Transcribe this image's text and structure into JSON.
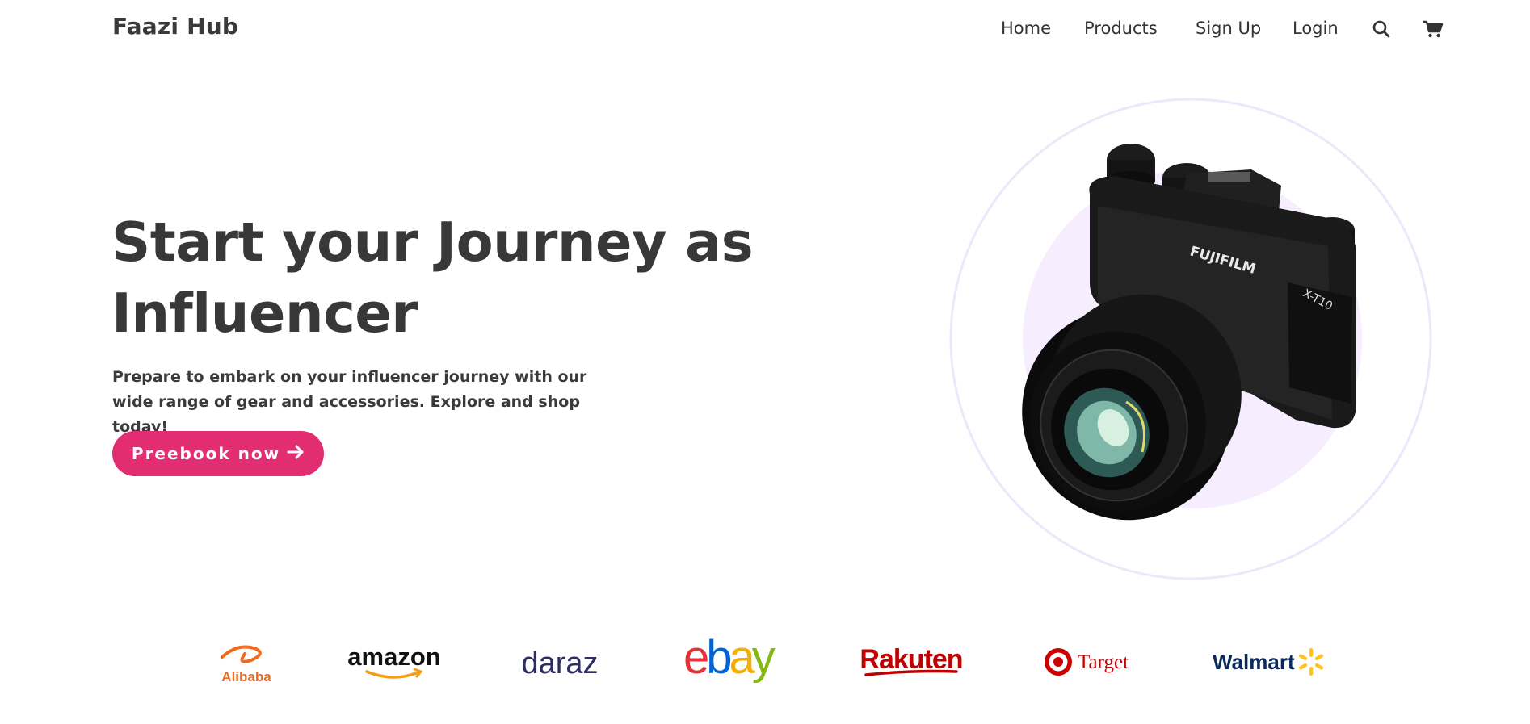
{
  "nav": {
    "brand": "Faazi Hub",
    "links": [
      "Home",
      "Products",
      "Sign Up",
      "Login"
    ],
    "icons": [
      "search-icon",
      "cart-icon"
    ]
  },
  "hero": {
    "title": "Start your Journey as Influencer",
    "description": "Prepare to embark on your influencer journey with our wide range of gear and accessories. Explore and shop today!",
    "cta_label": "Preebook now",
    "cta_icon": "arrow-right-icon",
    "image": "camera-image",
    "camera_brand": "FUJIFILM",
    "camera_model": "X-T10"
  },
  "partners": {
    "alibaba": "Alibaba",
    "amazon": "amazon",
    "daraz": "daraz",
    "ebay": "ebay",
    "rakuten": "Rakuten",
    "target": "Target",
    "walmart": "Walmart"
  },
  "colors": {
    "accent": "#e22d73",
    "text": "#333333",
    "circle_fill": "#f6eefe",
    "circle_stroke": "#efe6fb"
  }
}
